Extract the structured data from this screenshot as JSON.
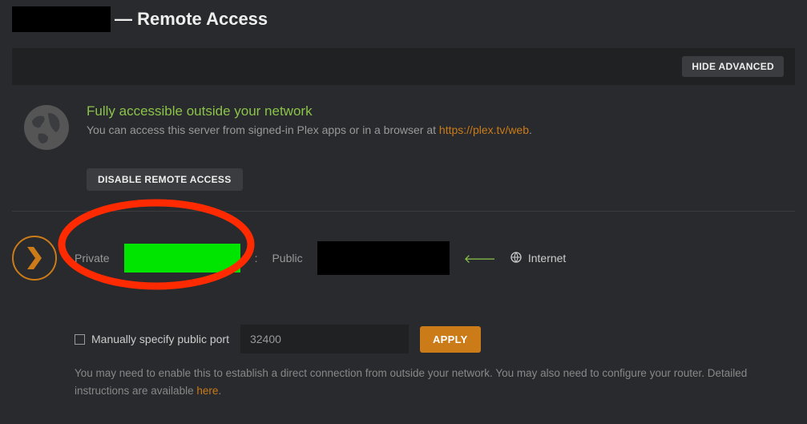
{
  "header": {
    "title_suffix": "— Remote Access"
  },
  "advanced": {
    "hide_label": "HIDE ADVANCED"
  },
  "status": {
    "title": "Fully accessible outside your network",
    "desc_prefix": "You can access this server from signed-in Plex apps or in a browser at ",
    "link_text": "https://plex.tv/web",
    "desc_suffix": "."
  },
  "disable": {
    "label": "DISABLE REMOTE ACCESS"
  },
  "conn": {
    "private_label": "Private",
    "colon": ": ",
    "public_label": "Public",
    "internet_label": "Internet"
  },
  "port": {
    "checkbox_label": "Manually specify public port",
    "value": "32400",
    "apply_label": "APPLY"
  },
  "help": {
    "text_prefix": "You may need to enable this to establish a direct connection from outside your network. You may also need to configure your router. Detailed instructions are available ",
    "link_text": "here",
    "text_suffix": "."
  }
}
